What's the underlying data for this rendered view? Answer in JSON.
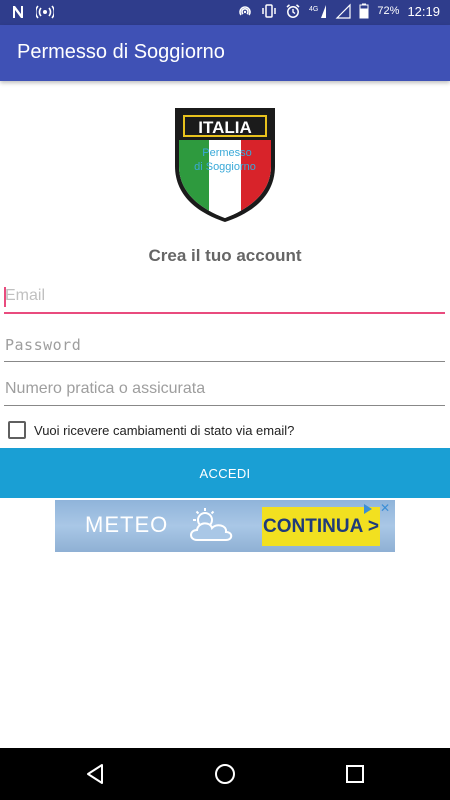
{
  "status_bar": {
    "left_icons": [
      "n-notification-icon",
      "hotspot-icon"
    ],
    "right_icons": [
      "nfc-icon",
      "vibrate-icon",
      "alarm-icon",
      "signal-4g-icon",
      "signal-icon",
      "battery-icon"
    ],
    "network": "4G",
    "battery": "72%",
    "time": "12:19"
  },
  "app_bar": {
    "title": "Permesso di Soggiorno",
    "color": "#3f51b5"
  },
  "logo": {
    "top_text": "ITALIA",
    "overlay_text_1": "Permesso",
    "overlay_text_2": "di Soggiorno"
  },
  "form": {
    "heading": "Crea il tuo account",
    "email_placeholder": "Email",
    "password_placeholder": "Password",
    "numero_placeholder": "Numero pratica o assicurata",
    "checkbox_label": "Vuoi ricevere cambiamenti di stato via email?",
    "checkbox_checked": false,
    "submit_label": "ACCEDI",
    "accent_color": "#e94b7e",
    "button_color": "#1a9fd4"
  },
  "ad": {
    "text": "METEO",
    "cta": "CONTINUA >",
    "close": "✕"
  },
  "nav_bar": {
    "icons": [
      "back-icon",
      "home-icon",
      "recents-icon"
    ]
  }
}
